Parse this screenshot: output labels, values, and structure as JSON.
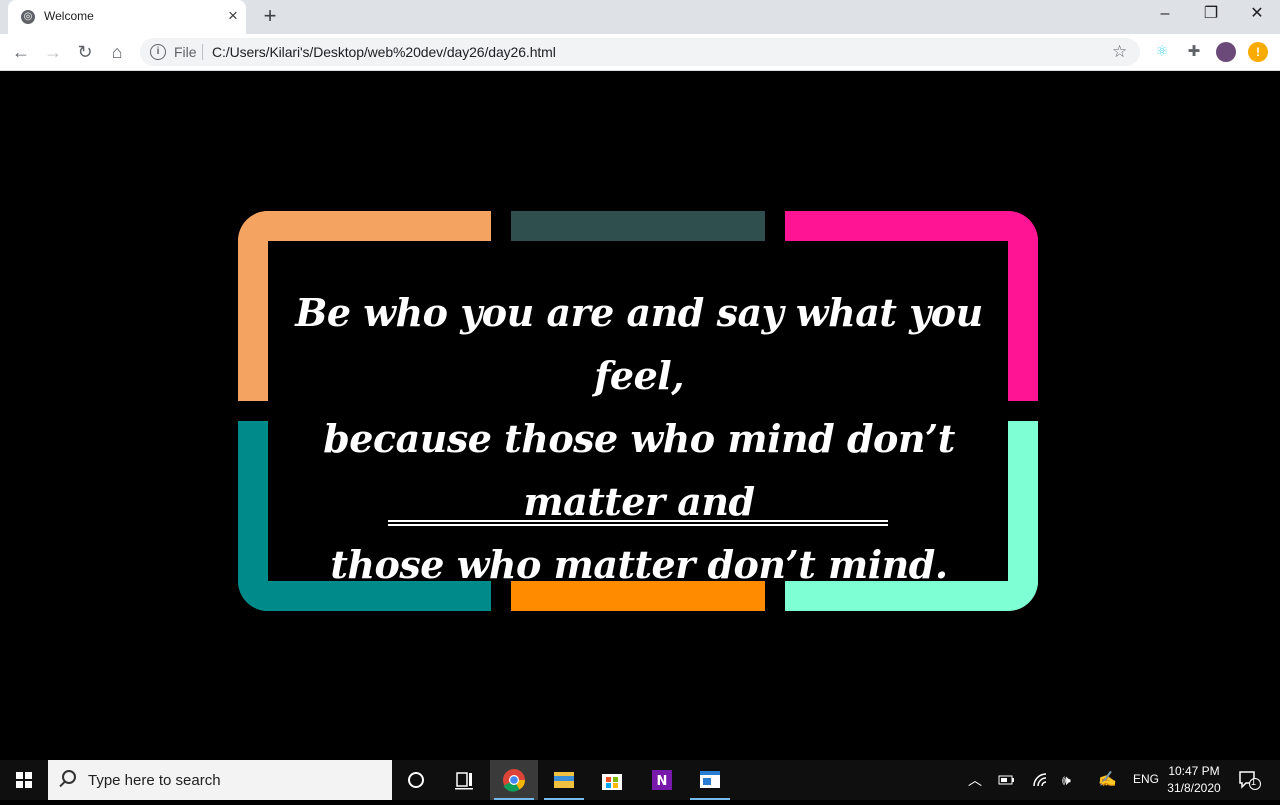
{
  "browser": {
    "tab": {
      "title": "Welcome"
    },
    "address": {
      "scheme_label": "File",
      "url": "C:/Users/Kilari's/Desktop/web%20dev/day26/day26.html"
    }
  },
  "page": {
    "quote_lines": [
      "Be who you are and say what you feel,",
      "because those who mind don’t matter and",
      "those who matter don’t mind."
    ],
    "frame_colors": {
      "top_left": "#f4a460",
      "top_center": "#2f4f4f",
      "top_right": "#ff1493",
      "bottom_left": "#008b8b",
      "bottom_center": "#ff8c00",
      "bottom_right": "#7fffd4"
    }
  },
  "taskbar": {
    "search_placeholder": "Type here to search",
    "language": "ENG",
    "time": "10:47 PM",
    "date": "31/8/2020",
    "notification_count": "1"
  },
  "icons": [
    "globe-icon",
    "close-icon",
    "plus-icon",
    "back-arrow-icon",
    "forward-arrow-icon",
    "reload-icon",
    "home-icon",
    "info-icon",
    "star-icon",
    "react-extension-icon",
    "puzzle-extension-icon",
    "profile-avatar",
    "update-alert-icon",
    "windows-logo-icon",
    "search-icon",
    "cortana-circle-icon",
    "task-view-icon",
    "chrome-icon",
    "file-explorer-icon",
    "store-icon",
    "onenote-icon",
    "app-window-icon",
    "chevron-up-icon",
    "battery-icon",
    "wifi-icon",
    "volume-icon",
    "pen-icon",
    "notification-icon"
  ]
}
